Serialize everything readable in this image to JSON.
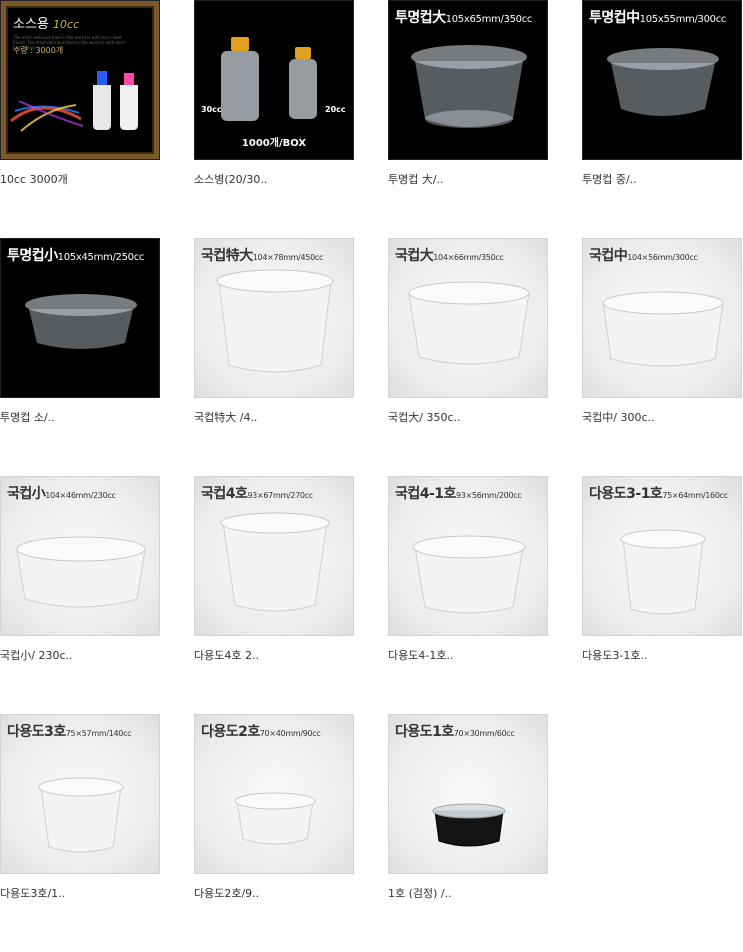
{
  "products": [
    {
      "caption": "10cc 3000개",
      "title": "소스용",
      "title_sub": "10cc",
      "qty": "수량 : 3000개",
      "note": "The most delicious food in the world is with one's best friend. The most delicious food in the world is with one's best friend."
    },
    {
      "caption": "소스병(20/30..",
      "box_label": "1000개/BOX",
      "vol_left": "30cc",
      "vol_right": "20cc"
    },
    {
      "caption": "투명컵 大/..",
      "title": "투명컵大",
      "spec": "105x65mm/350cc"
    },
    {
      "caption": "투명컵 중/..",
      "title": "투명컵中",
      "spec": "105x55mm/300cc"
    },
    {
      "caption": "투명컵 소/..",
      "title": "투명컵小",
      "spec": "105x45mm/250cc"
    },
    {
      "caption": "국컵特大 /4..",
      "title": "국컵特大",
      "spec": "104×78mm/450cc"
    },
    {
      "caption": "국컵大/ 350c..",
      "title": "국컵大",
      "spec": "104×66mm/350cc"
    },
    {
      "caption": "국컵中/ 300c..",
      "title": "국컵中",
      "spec": "104×56mm/300cc"
    },
    {
      "caption": "국컵小/ 230c..",
      "title": "국컵小",
      "spec": "104×46mm/230cc"
    },
    {
      "caption": "다용도4호 2..",
      "title": "국컵4호",
      "spec": "93×67mm/270cc"
    },
    {
      "caption": "다용도4-1호..",
      "title": "국컵4-1호",
      "spec": "93×56mm/200cc"
    },
    {
      "caption": "다용도3-1호..",
      "title": "다용도3-1호",
      "spec": "75×64mm/160cc"
    },
    {
      "caption": "다용도3호/1..",
      "title": "다용도3호",
      "spec": "75×57mm/140cc"
    },
    {
      "caption": "다용도2호/9..",
      "title": "다용도2호",
      "spec": "70×40mm/90cc"
    },
    {
      "caption": "1호 (검정) /..",
      "title": "다용도1호",
      "spec": "70×30mm/60cc"
    }
  ]
}
